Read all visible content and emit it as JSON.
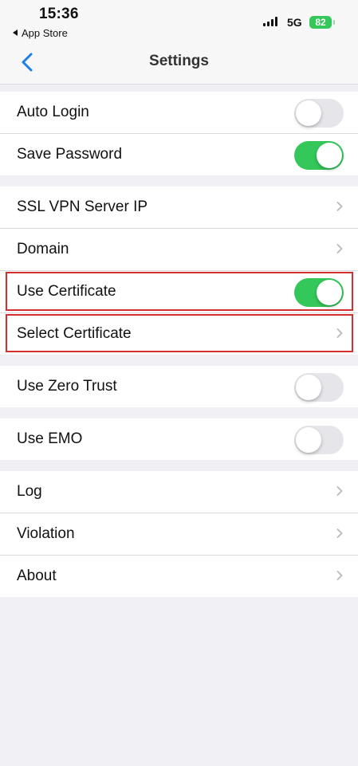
{
  "status_bar": {
    "time": "15:36",
    "back_app": "App Store",
    "network": "5G",
    "battery": "82"
  },
  "navbar": {
    "title": "Settings",
    "back_icon": "chevron-left-icon"
  },
  "groups": [
    {
      "rows": [
        {
          "label": "Auto Login",
          "control": "toggle",
          "on": false
        },
        {
          "label": "Save Password",
          "control": "toggle",
          "on": true
        }
      ]
    },
    {
      "rows": [
        {
          "label": "SSL VPN Server IP",
          "control": "chevron"
        },
        {
          "label": "Domain",
          "control": "chevron"
        },
        {
          "label": "Use Certificate",
          "control": "toggle",
          "on": true,
          "highlighted": true
        },
        {
          "label": "Select Certificate",
          "control": "chevron",
          "highlighted": true
        }
      ]
    },
    {
      "rows": [
        {
          "label": "Use Zero Trust",
          "control": "toggle",
          "on": false
        }
      ]
    },
    {
      "rows": [
        {
          "label": "Use EMO",
          "control": "toggle",
          "on": false
        }
      ]
    },
    {
      "rows": [
        {
          "label": "Log",
          "control": "chevron"
        },
        {
          "label": "Violation",
          "control": "chevron"
        },
        {
          "label": "About",
          "control": "chevron"
        }
      ]
    }
  ],
  "colors": {
    "toggle_on": "#34c759",
    "toggle_off": "#e6e6ea",
    "accent": "#1a7fe8",
    "highlight_box": "#d32f2f"
  }
}
